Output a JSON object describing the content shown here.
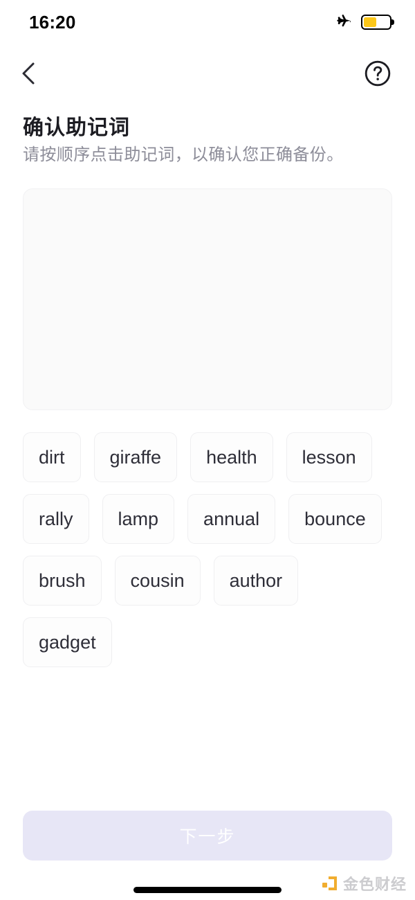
{
  "status_bar": {
    "time": "16:20",
    "airplane_icon": "airplane-mode-icon",
    "battery_icon": "battery-icon",
    "battery_level_percent": 50,
    "battery_color": "#fcc719"
  },
  "nav": {
    "back_icon": "chevron-left-icon",
    "help_icon": "question-mark-circle-icon"
  },
  "header": {
    "title": "确认助记词",
    "subtitle": "请按顺序点击助记词，以确认您正确备份。"
  },
  "answer_area": {
    "selected_words": [],
    "background_color": "#fafafa"
  },
  "word_pool": {
    "words": [
      "dirt",
      "giraffe",
      "health",
      "lesson",
      "rally",
      "lamp",
      "annual",
      "bounce",
      "brush",
      "cousin",
      "author",
      "gadget"
    ]
  },
  "footer": {
    "next_label": "下一步",
    "next_enabled": false,
    "next_background_color": "#e7e6f6"
  },
  "watermark": {
    "text": "金色财经",
    "logo_color": "#f0a71e"
  }
}
